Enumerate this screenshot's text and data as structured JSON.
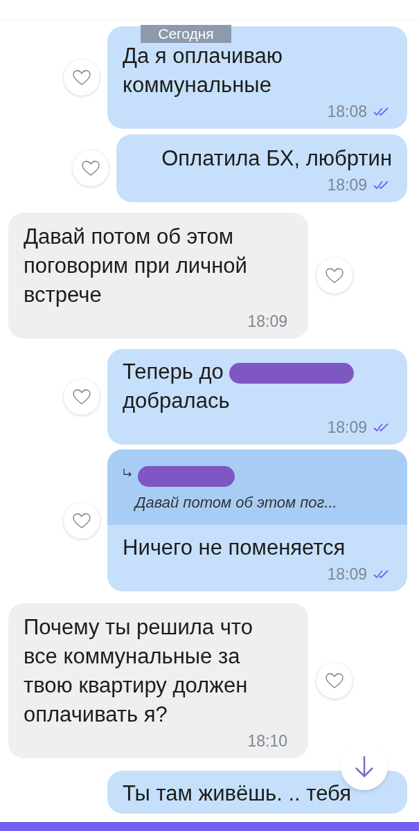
{
  "date_badge": "Сегодня",
  "messages": [
    {
      "kind": "outgoing",
      "text": "Да я оплачиваю коммунальные",
      "time": "18:08",
      "read": true,
      "liked": false
    },
    {
      "kind": "outgoing",
      "text": "Оплатила БХ, любртин",
      "time": "18:09",
      "read": true,
      "liked": false
    },
    {
      "kind": "incoming",
      "text": "Давай потом об этом поговорим при личной встрече",
      "time": "18:09",
      "liked": false
    },
    {
      "kind": "outgoing",
      "text": "Теперь до",
      "redacted": true,
      "text_after": "добралась",
      "time": "18:09",
      "read": true,
      "liked": false
    },
    {
      "kind": "outgoing",
      "reply": {
        "sender_redacted": true,
        "quote": "Давай потом об этом пог..."
      },
      "text": "Ничего не поменяется",
      "time": "18:09",
      "read": true,
      "liked": false
    },
    {
      "kind": "incoming",
      "text": "Почему ты решила что все коммунальные за твою квартиру должен оплачивать я?",
      "time": "18:10",
      "liked": false
    },
    {
      "kind": "outgoing",
      "text": "Ты там живёшь. .. тебя"
    }
  ]
}
